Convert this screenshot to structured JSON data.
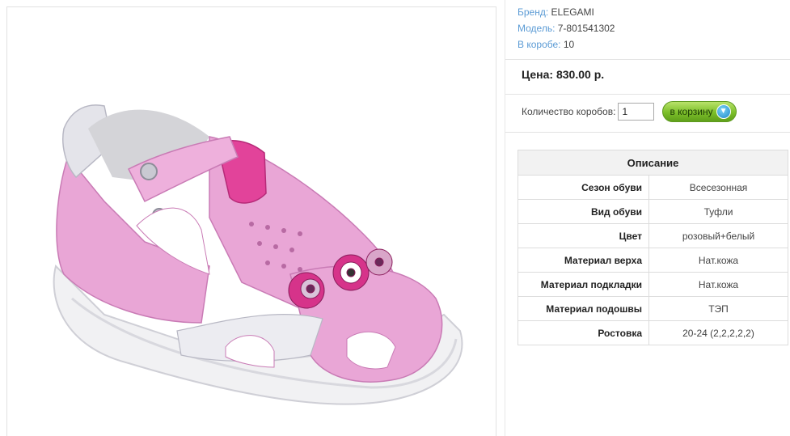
{
  "product": {
    "brand_label": "Бренд:",
    "brand": "ELEGAMI",
    "model_label": "Модель:",
    "model": "7-801541302",
    "box_label": "В коробе:",
    "box": "10",
    "price": "Цена: 830.00 р."
  },
  "order": {
    "qty_label": "Количество коробов:",
    "qty_value": "1",
    "cart_label": "в корзину",
    "cart_icon": "cart-down-arrow-icon"
  },
  "description": {
    "title": "Описание",
    "rows": [
      {
        "key": "Сезон обуви",
        "value": "Всесезонная"
      },
      {
        "key": "Вид обуви",
        "value": "Туфли"
      },
      {
        "key": "Цвет",
        "value": "розовый+белый"
      },
      {
        "key": "Материал верха",
        "value": "Нат.кожа"
      },
      {
        "key": "Материал подкладки",
        "value": "Нат.кожа"
      },
      {
        "key": "Материал подошвы",
        "value": "ТЭП"
      },
      {
        "key": "Ростовка",
        "value": "20-24 (2,2,2,2,2)"
      }
    ]
  },
  "colors": {
    "shoe_pink": "#e9a6d6",
    "shoe_magenta": "#e2439a",
    "sole": "#f1f1f3",
    "link_blue": "#5b9bd5",
    "button_green": "#7cbf2a"
  }
}
